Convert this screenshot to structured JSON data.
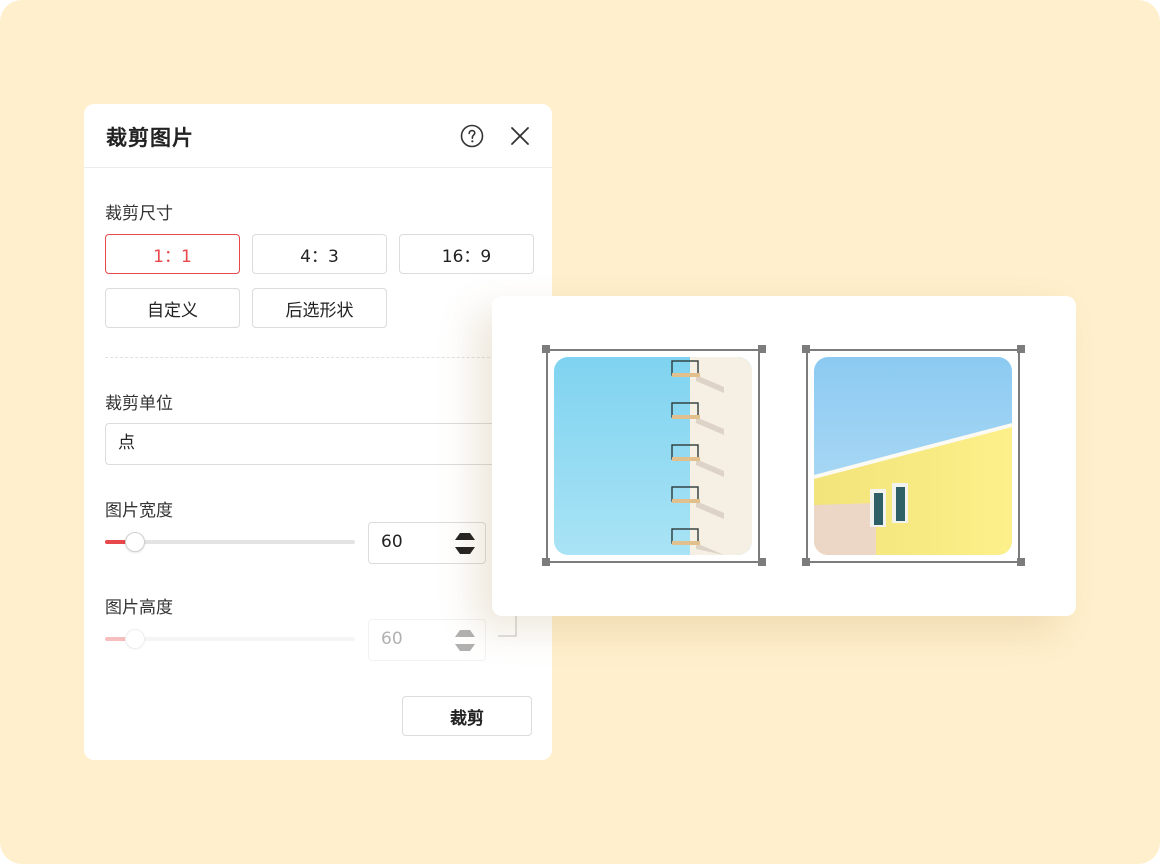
{
  "dialog": {
    "title": "裁剪图片",
    "help_icon": "help-circle-icon",
    "close_icon": "close-icon",
    "crop_size": {
      "label": "裁剪尺寸",
      "options": [
        "1：1",
        "4：3",
        "16：9",
        "自定义",
        "后选形状"
      ],
      "selected": "1：1"
    },
    "crop_unit": {
      "label": "裁剪单位",
      "value": "点"
    },
    "width": {
      "label": "图片宽度",
      "value": "60",
      "slider_fraction": 0.12
    },
    "height": {
      "label": "图片高度",
      "value": "60",
      "slider_fraction": 0.12,
      "disabled": true
    },
    "crop_button": "裁剪"
  },
  "colors": {
    "background": "#FFEFCC",
    "accent": "#E8474B",
    "frame": "#7C7C7C"
  }
}
